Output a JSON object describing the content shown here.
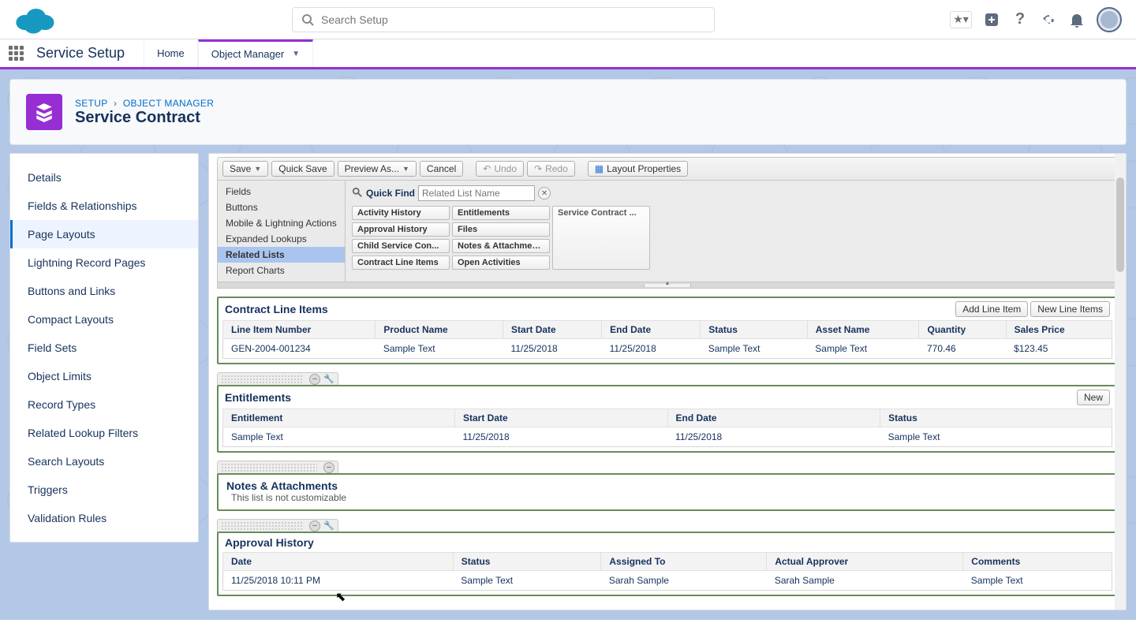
{
  "search": {
    "placeholder": "Search Setup"
  },
  "context": {
    "app_name": "Service Setup",
    "tabs": [
      {
        "label": "Home"
      },
      {
        "label": "Object Manager"
      }
    ]
  },
  "breadcrumb": {
    "root": "SETUP",
    "parent": "OBJECT MANAGER"
  },
  "page_title": "Service Contract",
  "sidebar": {
    "items": [
      "Details",
      "Fields & Relationships",
      "Page Layouts",
      "Lightning Record Pages",
      "Buttons and Links",
      "Compact Layouts",
      "Field Sets",
      "Object Limits",
      "Record Types",
      "Related Lookup Filters",
      "Search Layouts",
      "Triggers",
      "Validation Rules"
    ],
    "active_index": 2
  },
  "toolbar": {
    "save": "Save",
    "quick_save": "Quick Save",
    "preview_as": "Preview As...",
    "cancel": "Cancel",
    "undo": "Undo",
    "redo": "Redo",
    "layout_props": "Layout Properties"
  },
  "palette": {
    "quick_find_label": "Quick Find",
    "quick_find_placeholder": "Related List Name",
    "categories": [
      "Fields",
      "Buttons",
      "Mobile & Lightning Actions",
      "Expanded Lookups",
      "Related Lists",
      "Report Charts"
    ],
    "selected_category_index": 4,
    "chips_col1": [
      "Activity History",
      "Approval History",
      "Child Service Con...",
      "Contract Line Items"
    ],
    "chips_col2": [
      "Entitlements",
      "Files",
      "Notes & Attachments",
      "Open Activities"
    ],
    "chips_col3": [
      "Service Contract ..."
    ]
  },
  "related_lists": {
    "cli": {
      "title": "Contract Line Items",
      "buttons": [
        "Add Line Item",
        "New Line Items"
      ],
      "columns": [
        "Line Item Number",
        "Product Name",
        "Start Date",
        "End Date",
        "Status",
        "Asset Name",
        "Quantity",
        "Sales Price"
      ],
      "row": [
        "GEN-2004-001234",
        "Sample Text",
        "11/25/2018",
        "11/25/2018",
        "Sample Text",
        "Sample Text",
        "770.46",
        "$123.45"
      ]
    },
    "ent": {
      "title": "Entitlements",
      "buttons": [
        "New"
      ],
      "columns": [
        "Entitlement",
        "Start Date",
        "End Date",
        "Status"
      ],
      "row": [
        "Sample Text",
        "11/25/2018",
        "11/25/2018",
        "Sample Text"
      ]
    },
    "notes": {
      "title": "Notes & Attachments",
      "subtitle": "This list is not customizable"
    },
    "approval": {
      "title": "Approval History",
      "columns": [
        "Date",
        "Status",
        "Assigned To",
        "Actual Approver",
        "Comments"
      ],
      "row": [
        "11/25/2018 10:11 PM",
        "Sample Text",
        "Sarah Sample",
        "Sarah Sample",
        "Sample Text"
      ]
    }
  }
}
